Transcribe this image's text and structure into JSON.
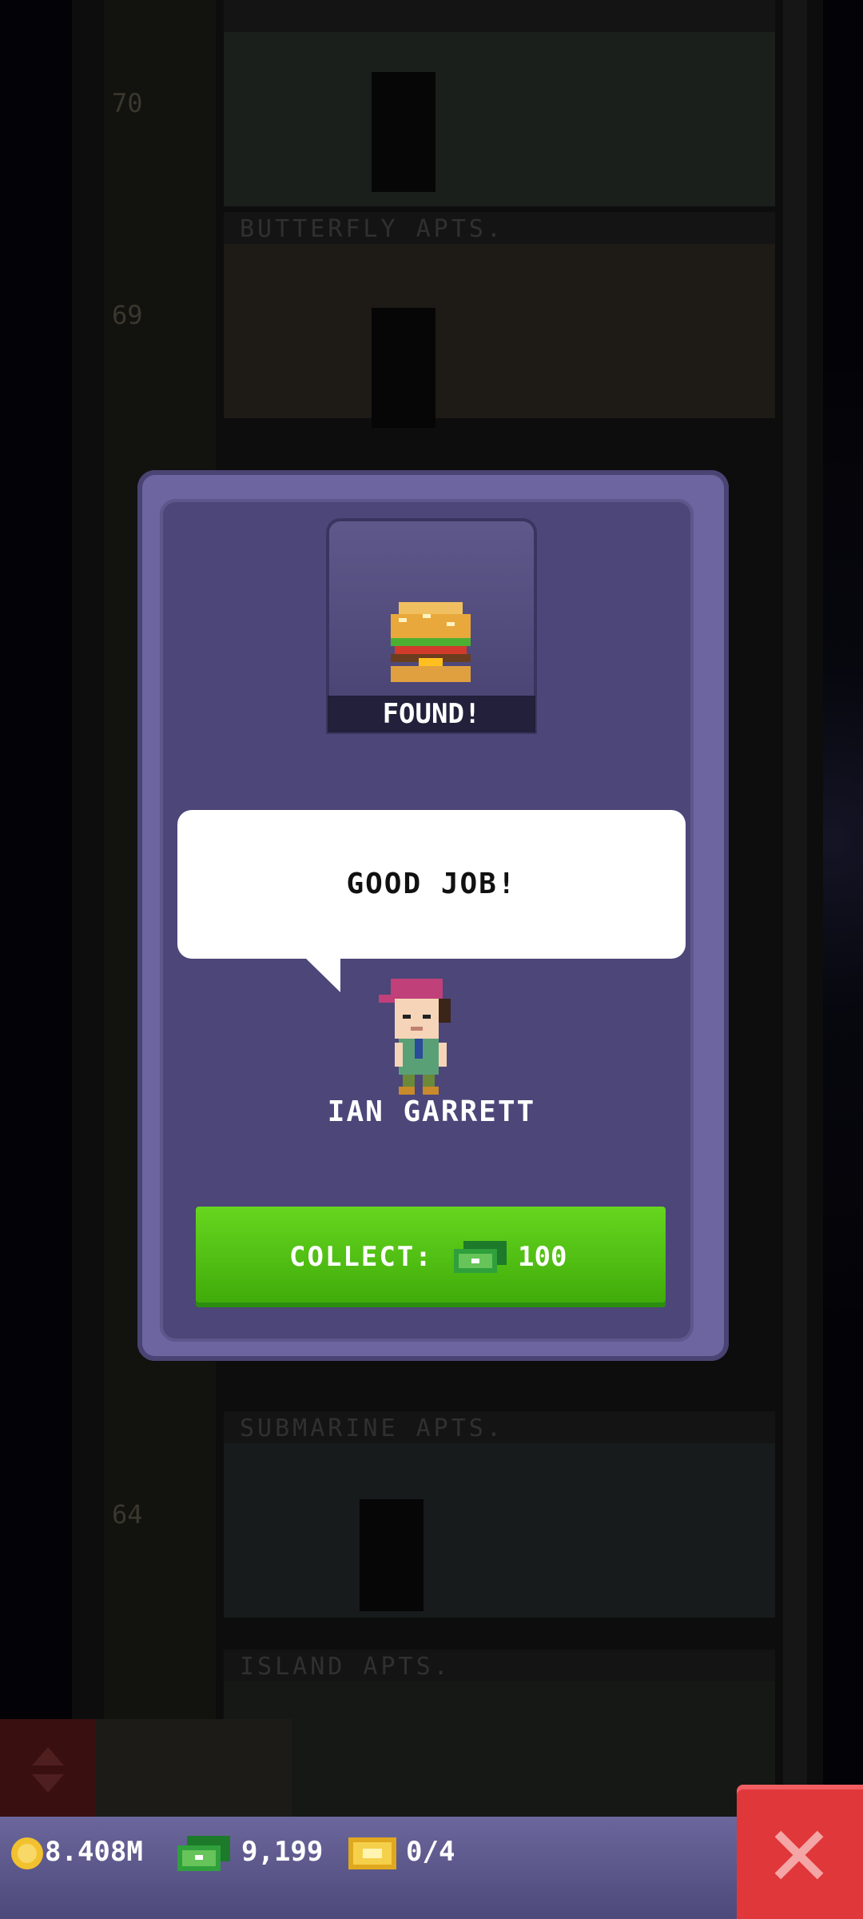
{
  "tower": {
    "floors": [
      {
        "name": "BUTTERFLY APTS.",
        "number": "69"
      },
      {
        "name": "SUBMARINE APTS.",
        "number": "64"
      },
      {
        "name": "ISLAND APTS.",
        "number": ""
      }
    ],
    "top_floor_number": "70"
  },
  "dialog": {
    "item_status": "FOUND!",
    "speech": "GOOD JOB!",
    "bitizen_name": "IAN GARRETT",
    "collect_label": "COLLECT:",
    "collect_amount": "100"
  },
  "status_bar": {
    "coins": "8.408M",
    "bux": "9,199",
    "tickets": "0/4"
  },
  "icons": {
    "coin": "coin-icon",
    "bux": "bux-icon",
    "ticket": "ticket-icon",
    "close": "close-icon",
    "item": "burger-icon"
  },
  "colors": {
    "dialog": "#6c659f",
    "collect_button": "#4cc214",
    "close_button": "#e0373a"
  }
}
